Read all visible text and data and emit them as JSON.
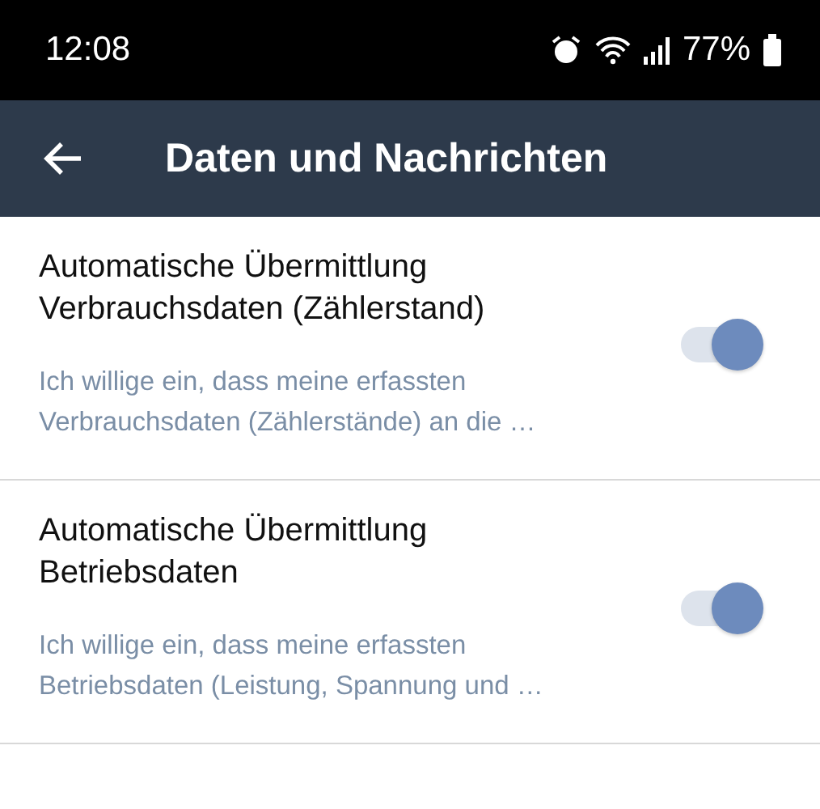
{
  "status_bar": {
    "time": "12:08",
    "battery": "77%"
  },
  "app_bar": {
    "title": "Daten und Nachrichten"
  },
  "settings": [
    {
      "title": "Automatische Übermittlung Verbrauchsdaten (Zählerstand)",
      "description": "Ich willige ein, dass meine erfassten Verbrauchsdaten (Zählerstände) an die …",
      "on": true
    },
    {
      "title": "Automatische Übermittlung Betriebsdaten",
      "description": "Ich willige ein, dass meine erfassten Betriebsdaten (Leistung, Spannung und …",
      "on": true
    }
  ]
}
